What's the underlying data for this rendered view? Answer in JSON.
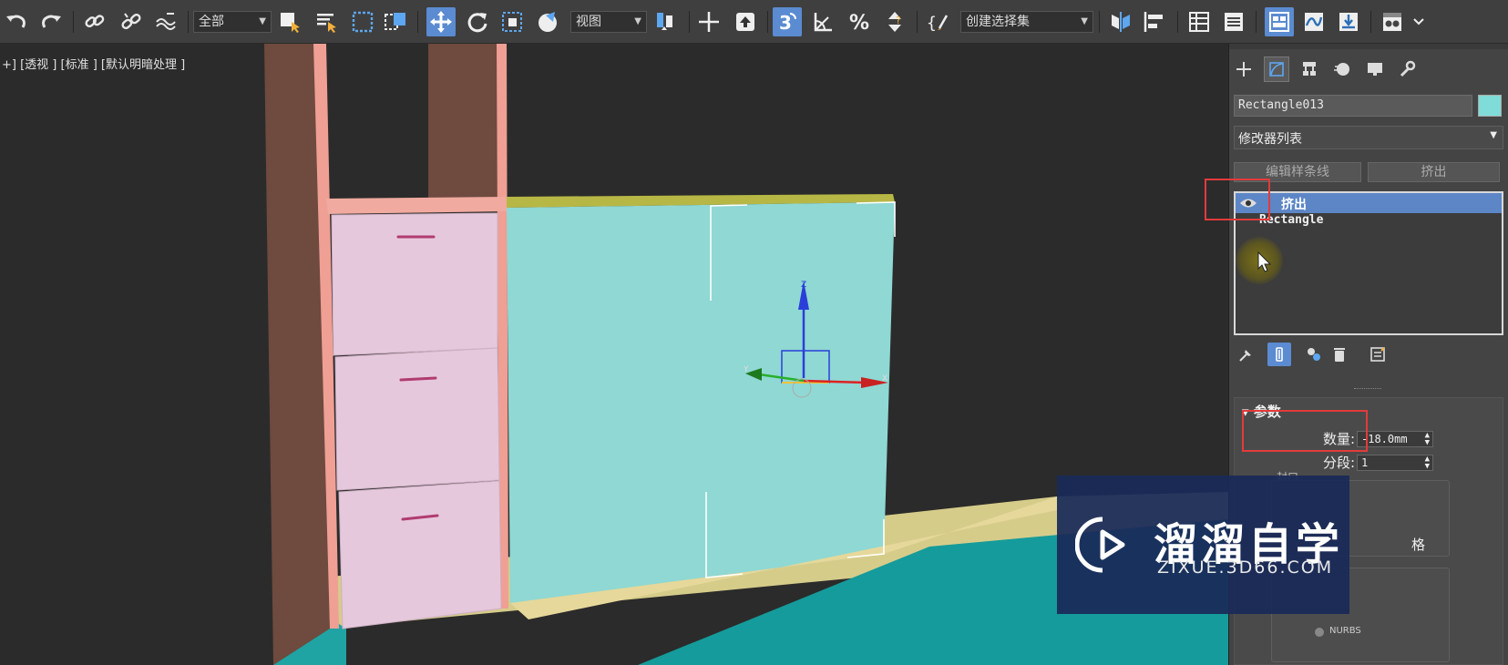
{
  "toolbar": {
    "selection_filter": "全部",
    "ref_coord": "视图",
    "named_selection": "创建选择集",
    "icons": [
      "undo-icon",
      "redo-icon",
      "link-icon",
      "unlink-icon",
      "bind-spacewarp-icon",
      "select-object-icon",
      "select-by-name-icon",
      "rect-region-icon",
      "window-crossing-icon",
      "select-move-icon",
      "select-rotate-icon",
      "select-scale-icon",
      "placement-icon",
      "select-manipulate-icon",
      "keyboard-shortcut-icon",
      "snaps-3d-icon",
      "angle-snap-icon",
      "percent-snap-icon",
      "spinner-snap-icon",
      "edit-named-sets-icon",
      "mirror-icon",
      "align-icon",
      "scene-explorer-icon",
      "layer-explorer-icon",
      "ribbon-icon",
      "curve-editor-icon",
      "schematic-view-icon",
      "material-editor-icon"
    ]
  },
  "viewport": {
    "label": "+] [透视 ] [标准 ] [默认明暗处理 ]",
    "gizmo_axes": {
      "x": "X",
      "y": "Y",
      "z": "Z"
    }
  },
  "panel": {
    "tabs": [
      "create-tab",
      "modify-tab",
      "hierarchy-tab",
      "motion-tab",
      "display-tab",
      "utilities-tab"
    ],
    "object_name": "Rectangle013",
    "object_color": "#7fdcd8",
    "modifier_list": "修改器列表",
    "buttons": {
      "edit_spline": "编辑样条线",
      "extrude": "挤出"
    },
    "stack": {
      "selected": "挤出",
      "base": "Rectangle"
    },
    "params": {
      "title": "参数",
      "amount_label": "数量:",
      "amount_value": "-18.0mm",
      "segments_label": "分段:",
      "segments_value": "1",
      "cap_label": "封口",
      "side_partial": "格",
      "nurbs": "NURBS"
    }
  },
  "watermark": {
    "title": "溜溜自学",
    "url": "ZIXUE.3D66.COM"
  },
  "colors": {
    "accent": "#5b8bd1",
    "highlight": "#e23b3b",
    "cabinet_face": "#8fd8d4",
    "drawer": "#e6c8dc",
    "frame": "#e9a397"
  }
}
